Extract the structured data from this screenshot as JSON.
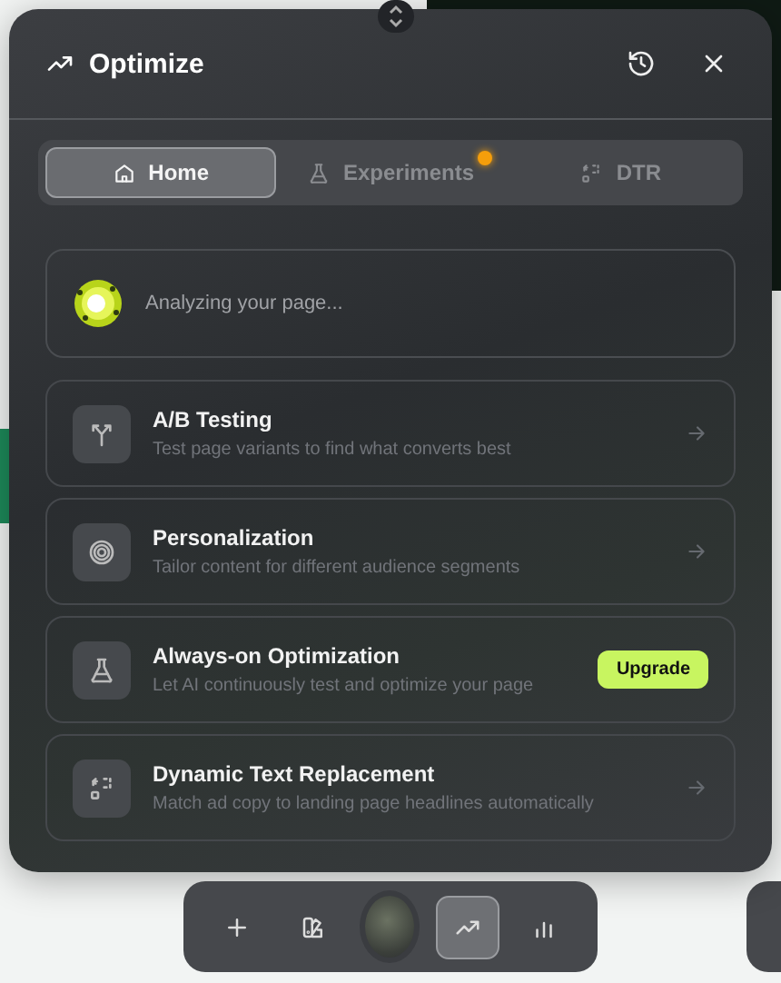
{
  "panel": {
    "title": "Optimize"
  },
  "tabs": [
    {
      "label": "Home",
      "kind": "home",
      "selected": true,
      "notification": false
    },
    {
      "label": "Experiments",
      "kind": "flask",
      "selected": false,
      "notification": true
    },
    {
      "label": "DTR",
      "kind": "dtr",
      "selected": false,
      "notification": false
    }
  ],
  "status": {
    "text": "Analyzing your page..."
  },
  "features": [
    {
      "title": "A/B Testing",
      "description": "Test page variants to find what converts best",
      "kind": "split",
      "action": {
        "kind": "arrow"
      }
    },
    {
      "title": "Personalization",
      "description": "Tailor content for different audience segments",
      "kind": "target",
      "action": {
        "kind": "arrow"
      }
    },
    {
      "title": "Always-on Optimization",
      "description": "Let AI continuously test and optimize your page",
      "kind": "flask",
      "action": {
        "kind": "upgrade",
        "label": "Upgrade"
      }
    },
    {
      "title": "Dynamic Text Replacement",
      "description": "Match ad copy to landing page headlines automatically",
      "kind": "dtr",
      "action": {
        "kind": "arrow"
      }
    }
  ],
  "toolbar": [
    {
      "kind": "plus",
      "selected": false
    },
    {
      "kind": "palette",
      "selected": false
    },
    {
      "kind": "orb",
      "selected": false
    },
    {
      "kind": "trend",
      "selected": true
    },
    {
      "kind": "bars",
      "selected": false
    }
  ]
}
